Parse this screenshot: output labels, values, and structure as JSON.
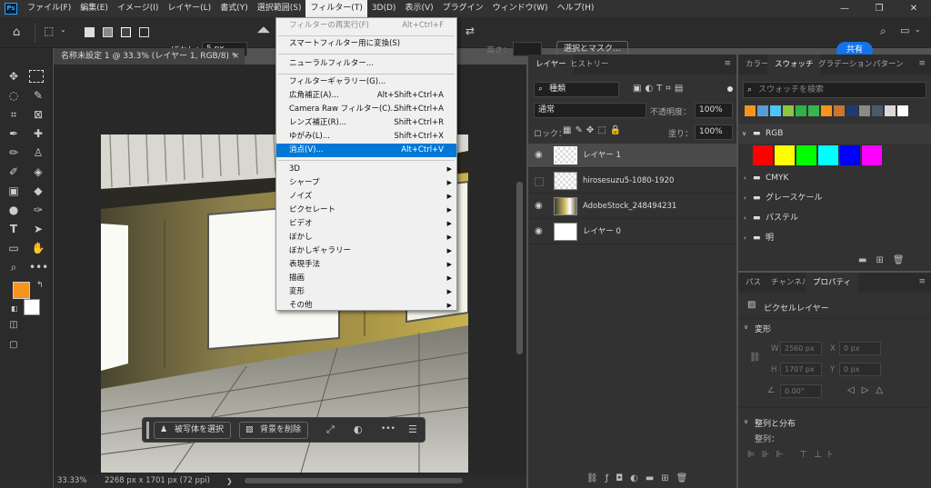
{
  "menubar": {
    "items": [
      "ファイル(F)",
      "編集(E)",
      "イメージ(I)",
      "レイヤー(L)",
      "書式(Y)",
      "選択範囲(S)",
      "フィルター(T)",
      "3D(D)",
      "表示(V)",
      "プラグイン",
      "ウィンドウ(W)",
      "ヘルプ(H)"
    ],
    "active_index": 6
  },
  "options": {
    "blur_label": "ぼかし：",
    "blur_value": "5 px",
    "height_label": "高さ：",
    "select_mask": "選択とマスク...",
    "share": "共有"
  },
  "document": {
    "tab_title": "名称未設定 1 @ 33.3% (レイヤー 1, RGB/8) *",
    "close": "×",
    "zoom": "33.33%",
    "dimensions": "2268 px x 1701 px (72 ppi)"
  },
  "context_bar": {
    "select_subject": "被写体を選択",
    "remove_background": "背景を削除",
    "more": "•••"
  },
  "filter_menu": {
    "items": [
      {
        "label": "フィルターの再実行(F)",
        "shortcut": "Alt+Ctrl+F",
        "disabled": true
      },
      {
        "label": "スマートフィルター用に変換(S)"
      },
      {
        "label": "ニューラルフィルター..."
      },
      {
        "label": "フィルターギャラリー(G)..."
      },
      {
        "label": "広角補正(A)...",
        "shortcut": "Alt+Shift+Ctrl+A"
      },
      {
        "label": "Camera Raw フィルター(C)...",
        "shortcut": "Shift+Ctrl+A"
      },
      {
        "label": "レンズ補正(R)...",
        "shortcut": "Shift+Ctrl+R"
      },
      {
        "label": "ゆがみ(L)...",
        "shortcut": "Shift+Ctrl+X"
      },
      {
        "label": "消点(V)...",
        "shortcut": "Alt+Ctrl+V",
        "highlighted": true
      },
      {
        "label": "3D",
        "submenu": true
      },
      {
        "label": "シャープ",
        "submenu": true
      },
      {
        "label": "ノイズ",
        "submenu": true
      },
      {
        "label": "ピクセレート",
        "submenu": true
      },
      {
        "label": "ビデオ",
        "submenu": true
      },
      {
        "label": "ぼかし",
        "submenu": true
      },
      {
        "label": "ぼかしギャラリー",
        "submenu": true
      },
      {
        "label": "表現手法",
        "submenu": true
      },
      {
        "label": "描画",
        "submenu": true
      },
      {
        "label": "変形",
        "submenu": true
      },
      {
        "label": "その他",
        "submenu": true
      }
    ],
    "arrow": "▶"
  },
  "layers_panel": {
    "tabs": [
      "レイヤー",
      "ヒストリー"
    ],
    "filter_kind": "種類",
    "blend_mode": "通常",
    "opacity_label": "不透明度：",
    "opacity_value": "100%",
    "lock_label": "ロック：",
    "fill_label": "塗り：",
    "fill_value": "100%",
    "layers": [
      {
        "name": "レイヤー 1",
        "visible": true,
        "selected": true
      },
      {
        "name": "hirosesuzu5-1080-1920",
        "visible": false
      },
      {
        "name": "AdobeStock_248494231",
        "visible": true
      },
      {
        "name": "レイヤー 0",
        "visible": true
      }
    ]
  },
  "swatches_panel": {
    "tabs": [
      "カラー",
      "スウォッチ",
      "グラデーション",
      "パターン"
    ],
    "search_placeholder": "スウォッチを検索",
    "recent_colors": [
      "#f7941d",
      "#5b9bd5",
      "#4fc3f7",
      "#8dc63f",
      "#2db34a",
      "#39b54a",
      "#f7941d",
      "#c87533",
      "#1f3b73",
      "#8a8a8a",
      "#4a5a6a",
      "#d9d9d9",
      "#ffffff"
    ],
    "rgb_group": "RGB",
    "rgb_colors": [
      "#ff0000",
      "#ffff00",
      "#00ff00",
      "#00ffff",
      "#0000ff",
      "#ff00ff"
    ],
    "groups": [
      "CMYK",
      "グレースケール",
      "パステル",
      "明"
    ]
  },
  "properties_panel": {
    "tabs": [
      "パス",
      "チャンネル",
      "プロパティ"
    ],
    "layer_type": "ピクセルレイヤー",
    "transform_title": "変形",
    "w_label": "W",
    "w_value": "2560 px",
    "x_label": "X",
    "x_value": "0 px",
    "h_label": "H",
    "h_value": "1707 px",
    "y_label": "Y",
    "y_value": "0 px",
    "angle_value": "0.00°",
    "align_title": "整列と分布",
    "align_label": "整列："
  },
  "colors": {
    "foreground": "#f7941d",
    "background": "#ffffff",
    "accent": "#1473e6",
    "menu_highlight": "#0078d7"
  }
}
